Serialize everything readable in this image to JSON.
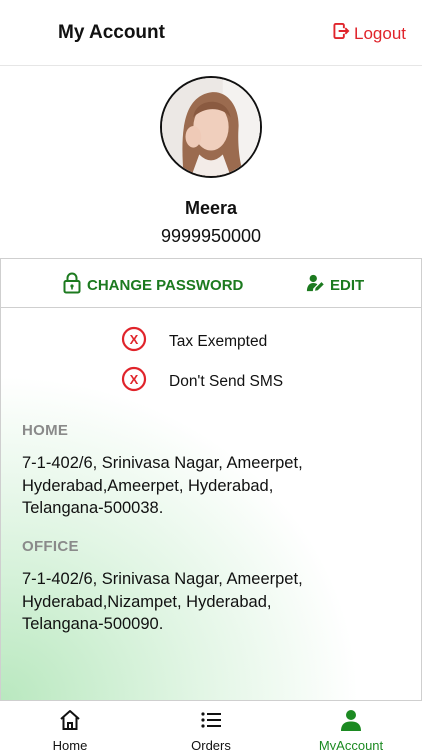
{
  "header": {
    "title": "My Account",
    "logout_label": "Logout"
  },
  "profile": {
    "name": "Meera",
    "phone": "9999950000"
  },
  "actions": {
    "change_password_label": "CHANGE PASSWORD",
    "edit_label": "EDIT"
  },
  "flags": [
    {
      "label": "Tax Exempted",
      "icon": "x-circle-icon"
    },
    {
      "label": "Don't Send SMS",
      "icon": "x-circle-icon"
    }
  ],
  "addresses": [
    {
      "type": "HOME",
      "lines": [
        "7-1-402/6, Srinivasa Nagar, Ameerpet,",
        "Hyderabad,Ameerpet, Hyderabad,",
        "Telangana-500038."
      ]
    },
    {
      "type": "OFFICE",
      "lines": [
        "7-1-402/6, Srinivasa Nagar, Ameerpet,",
        "Hyderabad,Nizampet, Hyderabad,",
        "Telangana-500090."
      ]
    }
  ],
  "tabs": [
    {
      "label": "Home",
      "icon": "home-icon"
    },
    {
      "label": "Orders",
      "icon": "list-icon"
    },
    {
      "label": "MyAccount",
      "icon": "person-icon",
      "active": true
    }
  ],
  "colors": {
    "accent_green": "#1c7a1f",
    "logout_red": "#e0242b",
    "flag_red": "#e0242b",
    "label_gray": "#8a8a8a"
  }
}
